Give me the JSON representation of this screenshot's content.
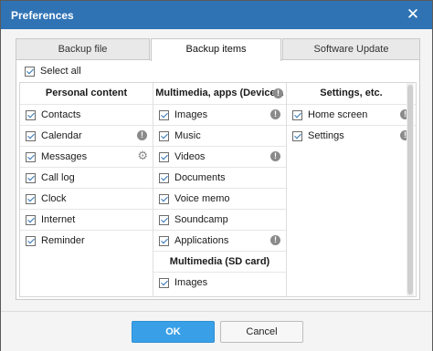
{
  "window": {
    "title": "Preferences",
    "close_glyph": "✕"
  },
  "tabs": [
    {
      "label": "Backup file",
      "active": false
    },
    {
      "label": "Backup items",
      "active": true
    },
    {
      "label": "Software Update",
      "active": false
    }
  ],
  "select_all": {
    "label": "Select all",
    "checked": true
  },
  "columns": {
    "personal": {
      "header": "Personal content",
      "items": [
        {
          "label": "Contacts",
          "checked": true,
          "icon": ""
        },
        {
          "label": "Calendar",
          "checked": true,
          "icon": "info-icon"
        },
        {
          "label": "Messages",
          "checked": true,
          "icon": "gear-icon"
        },
        {
          "label": "Call log",
          "checked": true,
          "icon": ""
        },
        {
          "label": "Clock",
          "checked": true,
          "icon": ""
        },
        {
          "label": "Internet",
          "checked": true,
          "icon": ""
        },
        {
          "label": "Reminder",
          "checked": true,
          "icon": ""
        }
      ]
    },
    "multimedia": {
      "header": "Multimedia, apps (Device...",
      "items": [
        {
          "label": "Images",
          "checked": true,
          "icon": "info-icon"
        },
        {
          "label": "Music",
          "checked": true,
          "icon": ""
        },
        {
          "label": "Videos",
          "checked": true,
          "icon": "info-icon"
        },
        {
          "label": "Documents",
          "checked": true,
          "icon": ""
        },
        {
          "label": "Voice memo",
          "checked": true,
          "icon": ""
        },
        {
          "label": "Soundcamp",
          "checked": true,
          "icon": ""
        },
        {
          "label": "Applications",
          "checked": true,
          "icon": "info-icon"
        }
      ],
      "sd_header": "Multimedia (SD card)",
      "sd_items": [
        {
          "label": "Images",
          "checked": true,
          "icon": ""
        }
      ]
    },
    "settings": {
      "header": "Settings, etc.",
      "items": [
        {
          "label": "Home screen",
          "checked": true,
          "icon": "info-icon"
        },
        {
          "label": "Settings",
          "checked": true,
          "icon": "info-icon"
        }
      ]
    }
  },
  "icons": {
    "info": "!",
    "gear": "⚙"
  },
  "buttons": {
    "ok": "OK",
    "cancel": "Cancel"
  },
  "colors": {
    "titlebar": "#2f73b5",
    "ok_button": "#39a0e8"
  }
}
